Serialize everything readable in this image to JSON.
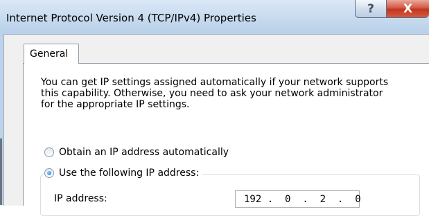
{
  "window": {
    "title": "Internet Protocol Version 4 (TCP/IPv4) Properties",
    "help_glyph": "?",
    "close_glyph": "X"
  },
  "tabs": [
    {
      "label": "General",
      "selected": true
    }
  ],
  "general": {
    "description": [
      "You can get IP settings assigned automatically if your network supports",
      "this capability. Otherwise, you need to ask your network administrator",
      "for the appropriate IP settings."
    ],
    "obtain_auto_label": "Obtain an IP address automatically",
    "obtain_auto_selected": false,
    "use_following_label": "Use the following IP address:",
    "use_following_selected": true,
    "ip_address_label": "IP address:",
    "ip_address": [
      "192",
      "0",
      "2",
      "0"
    ],
    "ip_separator": "."
  }
}
